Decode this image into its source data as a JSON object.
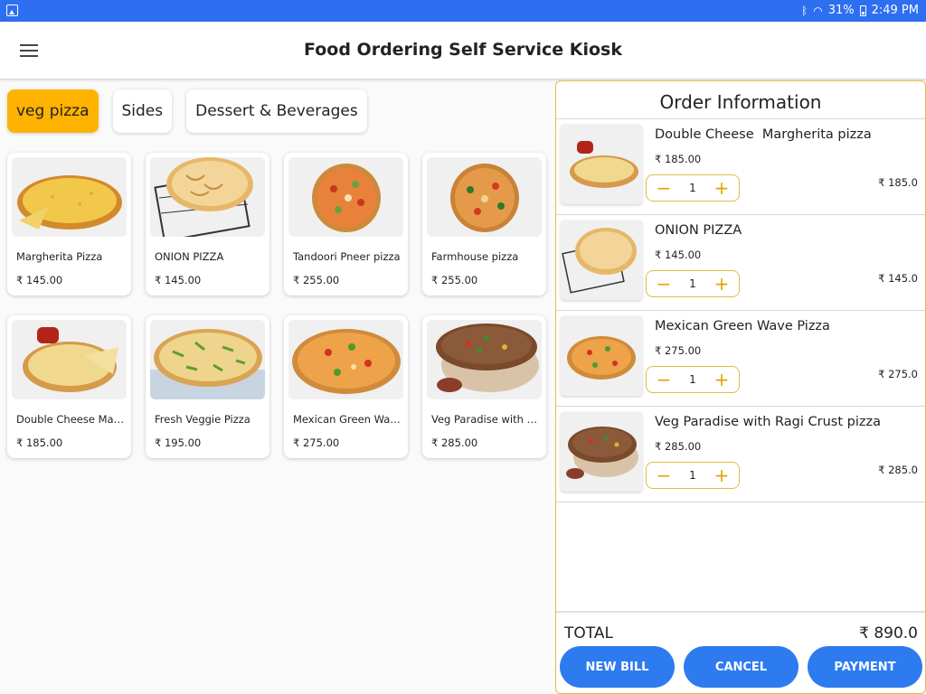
{
  "status_bar": {
    "battery": "31%",
    "time": "2:49 PM"
  },
  "app_bar": {
    "title": "Food Ordering Self Service Kiosk"
  },
  "categories": [
    {
      "label": "veg pizza",
      "active": true
    },
    {
      "label": "Sides",
      "active": false
    },
    {
      "label": "Dessert & Beverages",
      "active": false
    }
  ],
  "products": [
    {
      "name": "Margherita Pizza",
      "price": "₹ 145.00"
    },
    {
      "name": "ONION PIZZA",
      "price": "₹ 145.00"
    },
    {
      "name": "Tandoori Pneer pizza",
      "price": "₹ 255.00"
    },
    {
      "name": "Farmhouse pizza",
      "price": "₹ 255.00"
    },
    {
      "name": "Double Cheese  Mar...",
      "price": "₹ 185.00"
    },
    {
      "name": "Fresh Veggie Pizza",
      "price": "₹ 195.00"
    },
    {
      "name": "Mexican Green Wav...",
      "price": "₹ 275.00"
    },
    {
      "name": "Veg Paradise with Ra...",
      "price": "₹ 285.00"
    }
  ],
  "order": {
    "title": "Order Information",
    "items": [
      {
        "name": "Double Cheese  Margherita pizza",
        "price": "₹ 185.00",
        "qty": "1",
        "total": "₹ 185.0"
      },
      {
        "name": "ONION PIZZA",
        "price": "₹ 145.00",
        "qty": "1",
        "total": "₹ 145.0"
      },
      {
        "name": "Mexican Green Wave Pizza",
        "price": "₹ 275.00",
        "qty": "1",
        "total": "₹ 275.0"
      },
      {
        "name": "Veg Paradise with Ragi Crust pizza",
        "price": "₹ 285.00",
        "qty": "1",
        "total": "₹ 285.0"
      }
    ],
    "total_label": "TOTAL",
    "total_value": "₹ 890.0",
    "buttons": {
      "new_bill": "NEW BILL",
      "cancel": "CANCEL",
      "payment": "PAYMENT"
    }
  },
  "colors": {
    "accent": "#ffb300",
    "primary": "#2e7bf0",
    "status_bar": "#2e6ff2",
    "order_border": "#e3b94a"
  }
}
